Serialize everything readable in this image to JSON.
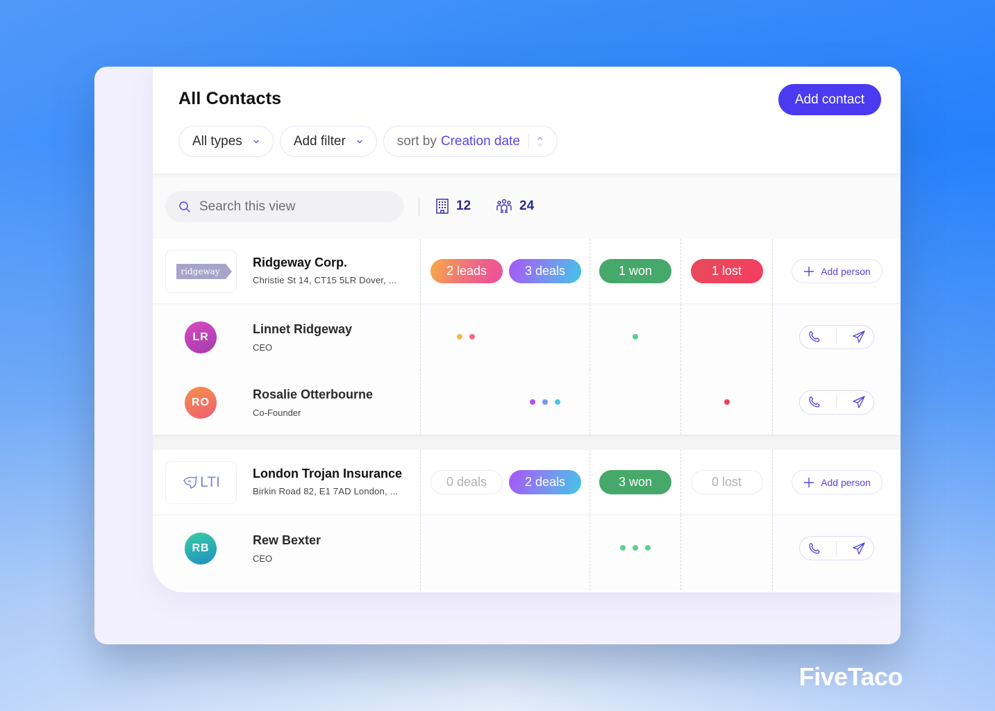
{
  "page": {
    "title": "All Contacts",
    "add_contact_label": "Add contact"
  },
  "filters": {
    "types_label": "All types",
    "add_filter_label": "Add filter",
    "sort_prefix": "sort by",
    "sort_value": "Creation date"
  },
  "toolbar": {
    "search_placeholder": "Search this view",
    "companies_count": "12",
    "people_count": "24"
  },
  "colors": {
    "accent": "#4a3bf0",
    "won": "#46a86a",
    "lost": "#f33e60",
    "dot_orange": "#f6b545",
    "dot_pink": "#f06a88",
    "dot_purple": "#b84ff2",
    "dot_blue": "#7a9ae6",
    "dot_cyan": "#44c7e4",
    "dot_green": "#5ad189",
    "dot_red": "#f0405e"
  },
  "companies": [
    {
      "name": "Ridgeway Corp.",
      "address": "Christie St 14, CT15 5LR Dover, ...",
      "logo_text": "ridgeway",
      "leads": "2 leads",
      "deals": "3 deals",
      "won": "1 won",
      "lost": "1 lost",
      "add_person_label": "Add person",
      "people": [
        {
          "initials": "LR",
          "name": "Linnet Ridgeway",
          "role": "CEO"
        },
        {
          "initials": "RO",
          "name": "Rosalie Otterbourne",
          "role": "Co-Founder"
        }
      ]
    },
    {
      "name": "London Trojan Insurance",
      "address": "Birkin Road 82, E1 7AD London, ...",
      "logo_text": "LTI",
      "leads": "0 deals",
      "deals": "2 deals",
      "won": "3 won",
      "lost": "0 lost",
      "add_person_label": "Add person",
      "people": [
        {
          "initials": "RB",
          "name": "Rew Bexter",
          "role": "CEO"
        }
      ]
    }
  ],
  "brand": "FiveTaco"
}
